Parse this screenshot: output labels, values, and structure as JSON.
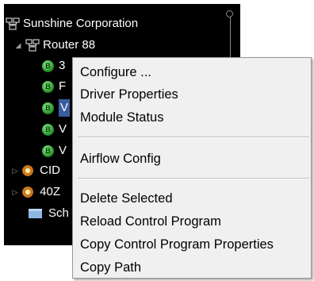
{
  "tree": {
    "root_label": "Sunshine Corporation",
    "router_label": "Router 88",
    "modules": [
      {
        "label": "3"
      },
      {
        "label": "F"
      },
      {
        "label": "V"
      },
      {
        "label": "V"
      },
      {
        "label": "V"
      }
    ],
    "devices": [
      {
        "label": "CID"
      },
      {
        "label": "40Z"
      }
    ],
    "folder_label": "Sch",
    "icon_names": {
      "root": "network-icon",
      "router": "network-icon",
      "module": "module-b-icon",
      "device": "device-icon",
      "folder": "folder-icon"
    }
  },
  "context_menu": {
    "items_group1": [
      "Configure ...",
      "Driver Properties",
      "Module Status"
    ],
    "items_group2": [
      "Airflow Config"
    ],
    "items_group3": [
      "Delete Selected",
      "Reload Control Program",
      "Copy Control Program Properties",
      "Copy Path"
    ]
  },
  "colors": {
    "tree_background": "#000000",
    "menu_background": "#f0f0f0",
    "selection": "#3b5d9e"
  }
}
